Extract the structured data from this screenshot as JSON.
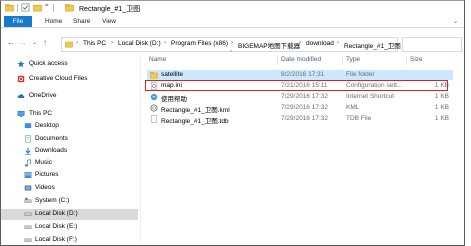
{
  "window": {
    "title": "Rectangle_#1_卫图"
  },
  "ribbon": {
    "file": "File",
    "tabs": [
      "Home",
      "Share",
      "View"
    ]
  },
  "address": {
    "crumbs": [
      "This PC",
      "Local Disk (D:)",
      "Program Files (x86)",
      "BIGEMAP地图下载器",
      "download",
      "Rectangle_#1_卫图"
    ]
  },
  "sidebar": {
    "items": [
      {
        "label": "Quick access",
        "icon": "star-icon"
      },
      {
        "label": "Creative Cloud Files",
        "icon": "creative-cloud-icon"
      },
      {
        "label": "OneDrive",
        "icon": "cloud-icon"
      },
      {
        "label": "This PC",
        "icon": "computer-icon"
      },
      {
        "label": "Desktop",
        "icon": "desktop-icon"
      },
      {
        "label": "Documents",
        "icon": "documents-icon"
      },
      {
        "label": "Downloads",
        "icon": "downloads-icon"
      },
      {
        "label": "Music",
        "icon": "music-icon"
      },
      {
        "label": "Pictures",
        "icon": "pictures-icon"
      },
      {
        "label": "Videos",
        "icon": "videos-icon"
      },
      {
        "label": "System (C:)",
        "icon": "drive-icon"
      },
      {
        "label": "Local Disk (D:)",
        "icon": "drive-icon"
      },
      {
        "label": "Local Disk (E:)",
        "icon": "drive-icon"
      },
      {
        "label": "Local Disk (F:)",
        "icon": "drive-icon"
      }
    ]
  },
  "list": {
    "columns": {
      "name": "Name",
      "date": "Date modified",
      "type": "Type",
      "size": "Size"
    },
    "rows": [
      {
        "name": "satellite",
        "date": "8/2/2016 17:31",
        "type": "File folder",
        "size": "",
        "icon": "folder-icon"
      },
      {
        "name": "map.ini",
        "date": "7/21/2016 15:11",
        "type": "Configuration sett...",
        "size": "1 KB",
        "icon": "ini-file-icon"
      },
      {
        "name": "使用帮助",
        "date": "7/29/2016 17:32",
        "type": "Internet Shortcut",
        "size": "1 KB",
        "icon": "internet-shortcut-icon"
      },
      {
        "name": "Rectangle_#1_卫图.kml",
        "date": "7/29/2016 17:32",
        "type": "KML",
        "size": "1 KB",
        "icon": "kml-file-icon"
      },
      {
        "name": "Rectangle_#1_卫图.tdb",
        "date": "7/29/2016 17:32",
        "type": "TDB File",
        "size": "1 KB",
        "icon": "tdb-file-icon"
      }
    ]
  },
  "colors": {
    "accent": "#1979ca",
    "selection": "#cce8ff",
    "highlight": "#e02020",
    "folder": "#f2c94c"
  }
}
